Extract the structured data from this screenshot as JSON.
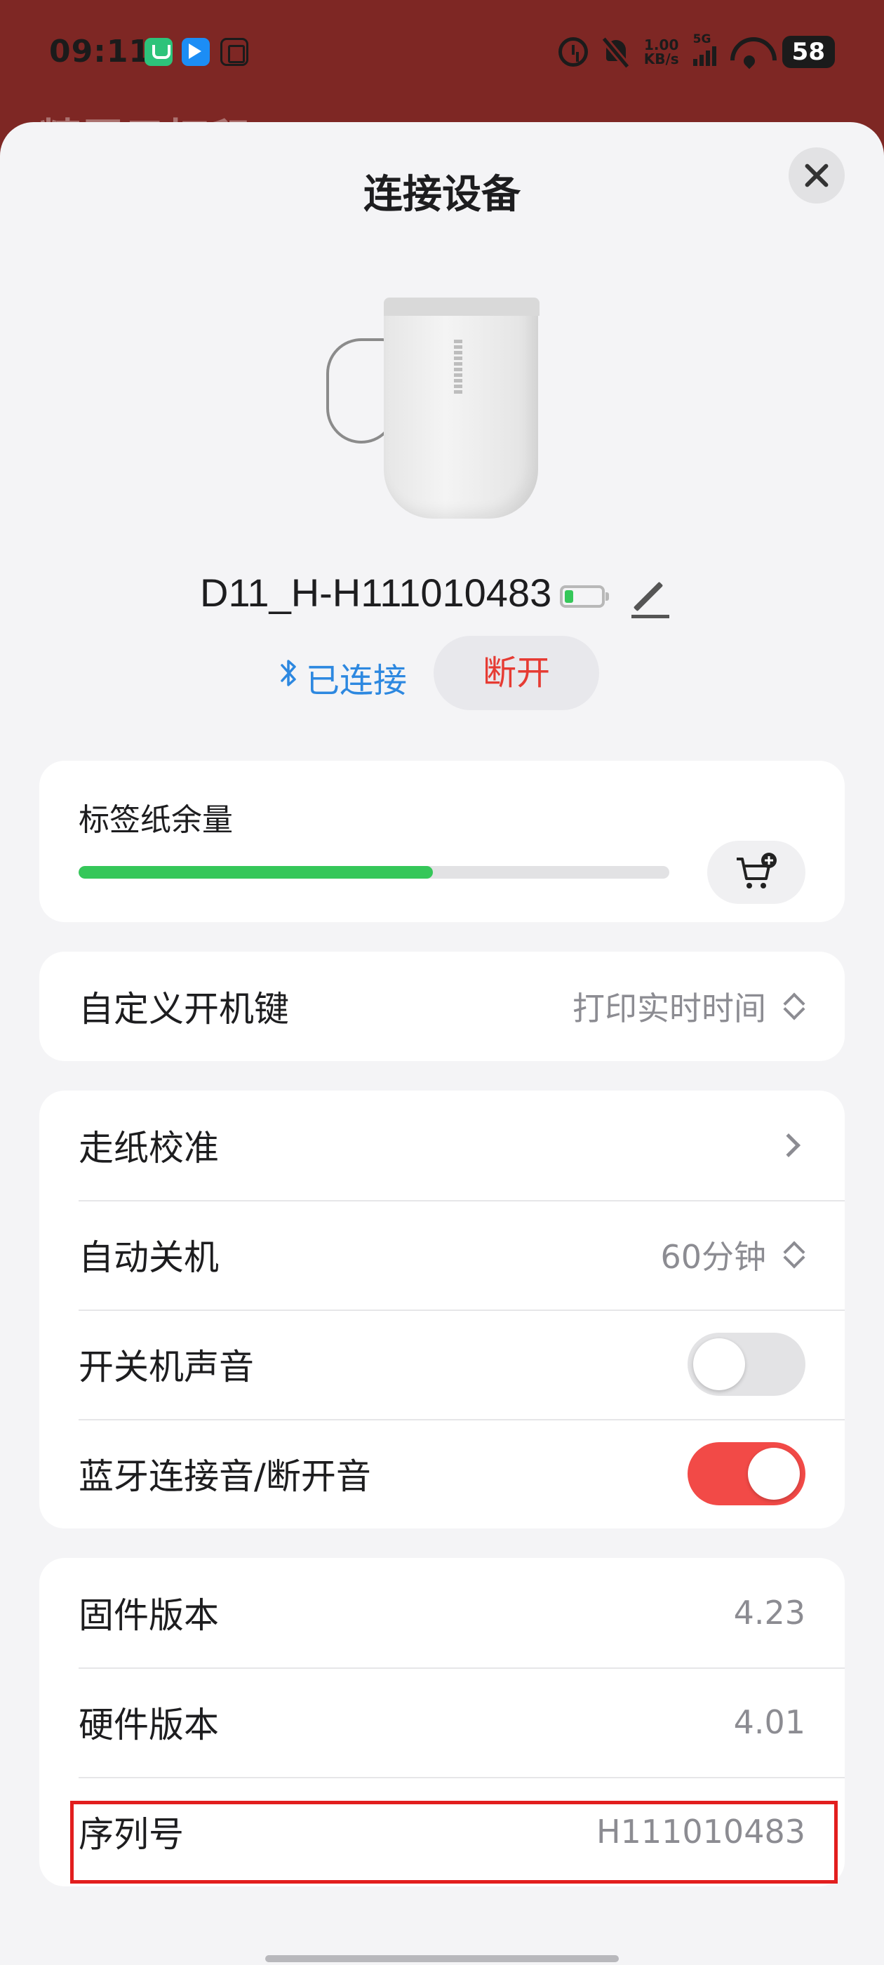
{
  "status_bar": {
    "time": "09:11",
    "net_speed_value": "1.00",
    "net_speed_unit": "KB/s",
    "network_type": "5G",
    "battery_level": "58"
  },
  "background_app": {
    "title": "精臣云打印"
  },
  "sheet": {
    "title": "连接设备"
  },
  "device": {
    "name": "D11_H-H111010483",
    "connection_status": "已连接",
    "disconnect_label": "断开",
    "battery_level": 0.2
  },
  "paper": {
    "label": "标签纸余量",
    "remaining": 0.6
  },
  "power_key": {
    "label": "自定义开机键",
    "value": "打印实时时间"
  },
  "settings": {
    "paper_calibration": "走纸校准",
    "auto_shutdown_label": "自动关机",
    "auto_shutdown_value": "60分钟",
    "power_sound_label": "开关机声音",
    "power_sound_on": false,
    "bt_sound_label": "蓝牙连接音/断开音",
    "bt_sound_on": true
  },
  "info": {
    "firmware_label": "固件版本",
    "firmware_value": "4.23",
    "hardware_label": "硬件版本",
    "hardware_value": "4.01",
    "serial_label": "序列号",
    "serial_value": "H111010483"
  },
  "colors": {
    "accent_red": "#f24a47",
    "connected_blue": "#2d88e0",
    "progress_green": "#35c759",
    "highlight": "#e21e1e"
  }
}
